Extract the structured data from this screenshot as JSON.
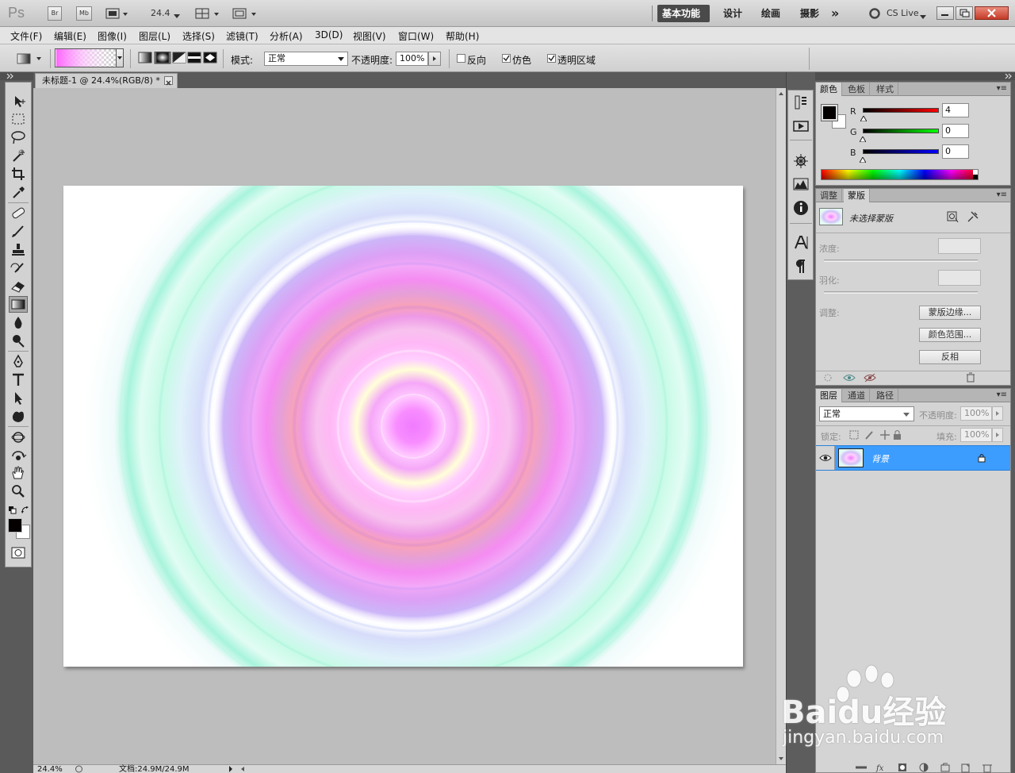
{
  "titlebar": {
    "app_logo": "Ps",
    "bridge_label": "Br",
    "minibridge_label": "Mb",
    "zoom": "24.4",
    "workspaces": [
      "基本功能",
      "设计",
      "绘画",
      "摄影"
    ],
    "more": "»",
    "cs_live": "CS Live"
  },
  "menu": [
    "文件(F)",
    "编辑(E)",
    "图像(I)",
    "图层(L)",
    "选择(S)",
    "滤镜(T)",
    "分析(A)",
    "3D(D)",
    "视图(V)",
    "窗口(W)",
    "帮助(H)"
  ],
  "options": {
    "mode_label": "模式:",
    "mode_value": "正常",
    "opacity_label": "不透明度:",
    "opacity_value": "100%",
    "reverse_label": "反向",
    "dither_label": "仿色",
    "transparency_label": "透明区域"
  },
  "document": {
    "tab_title": "未标题-1 @ 24.4%(RGB/8) *",
    "status_zoom": "24.4%",
    "status_doc": "文档:24.9M/24.9M"
  },
  "color_panel": {
    "tabs": [
      "颜色",
      "色板",
      "样式"
    ],
    "r_label": "R",
    "g_label": "G",
    "b_label": "B",
    "r": "4",
    "g": "0",
    "b": "0"
  },
  "masks_panel": {
    "tabs": [
      "调整",
      "蒙版"
    ],
    "title": "未选择蒙版",
    "density_label": "浓度:",
    "feather_label": "羽化:",
    "refine_label": "调整:",
    "mask_edge_button": "蒙版边缘...",
    "color_range_button": "颜色范围...",
    "invert_button": "反相"
  },
  "layers_panel": {
    "tabs": [
      "图层",
      "通道",
      "路径"
    ],
    "blend_mode": "正常",
    "opacity_label": "不透明度:",
    "opacity_value": "100%",
    "lock_label": "锁定:",
    "fill_label": "填充:",
    "fill_value": "100%",
    "layer_name": "背景"
  },
  "watermark": {
    "brand": "Baidu经验",
    "url": "jingyan.baidu.com"
  },
  "colors": {
    "accent": "#3d9dff",
    "foreground": "#040000",
    "background": "#ffffff"
  }
}
